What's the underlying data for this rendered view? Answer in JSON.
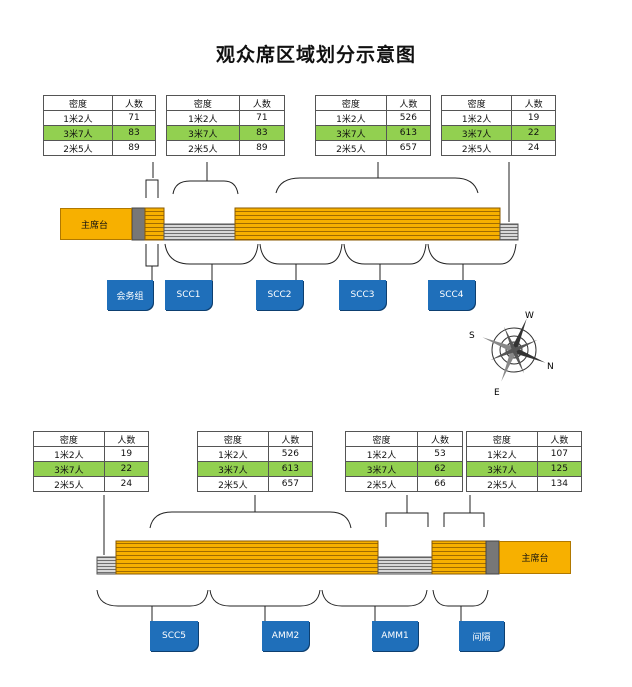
{
  "title": "观众席区域划分示意图",
  "table_headers": {
    "density": "密度",
    "count": "人数"
  },
  "tables": [
    {
      "rows": [
        [
          "1米2人",
          "71"
        ],
        [
          "3米7人",
          "83"
        ],
        [
          "2米5人",
          "89"
        ]
      ]
    },
    {
      "rows": [
        [
          "1米2人",
          "71"
        ],
        [
          "3米7人",
          "83"
        ],
        [
          "2米5人",
          "89"
        ]
      ]
    },
    {
      "rows": [
        [
          "1米2人",
          "526"
        ],
        [
          "3米7人",
          "613"
        ],
        [
          "2米5人",
          "657"
        ]
      ]
    },
    {
      "rows": [
        [
          "1米2人",
          "19"
        ],
        [
          "3米7人",
          "22"
        ],
        [
          "2米5人",
          "24"
        ]
      ]
    },
    {
      "rows": [
        [
          "1米2人",
          "19"
        ],
        [
          "3米7人",
          "22"
        ],
        [
          "2米5人",
          "24"
        ]
      ]
    },
    {
      "rows": [
        [
          "1米2人",
          "526"
        ],
        [
          "3米7人",
          "613"
        ],
        [
          "2米5人",
          "657"
        ]
      ]
    },
    {
      "rows": [
        [
          "1米2人",
          "53"
        ],
        [
          "3米7人",
          "62"
        ],
        [
          "2米5人",
          "66"
        ]
      ]
    },
    {
      "rows": [
        [
          "1米2人",
          "107"
        ],
        [
          "3米7人",
          "125"
        ],
        [
          "2米5人",
          "134"
        ]
      ]
    }
  ],
  "stage_label": "主席台",
  "labels_top": [
    "会务组",
    "SCC1",
    "SCC2",
    "SCC3",
    "SCC4"
  ],
  "labels_bottom": [
    "SCC5",
    "AMM2",
    "AMM1",
    "间隔"
  ],
  "compass": {
    "n": "N",
    "s": "S",
    "e": "E",
    "w": "W"
  },
  "colors": {
    "seat": "#f7b000",
    "seat_line": "#8a5a00",
    "highlight": "#92d050",
    "label": "#1f6fba",
    "gray": "#888888"
  }
}
